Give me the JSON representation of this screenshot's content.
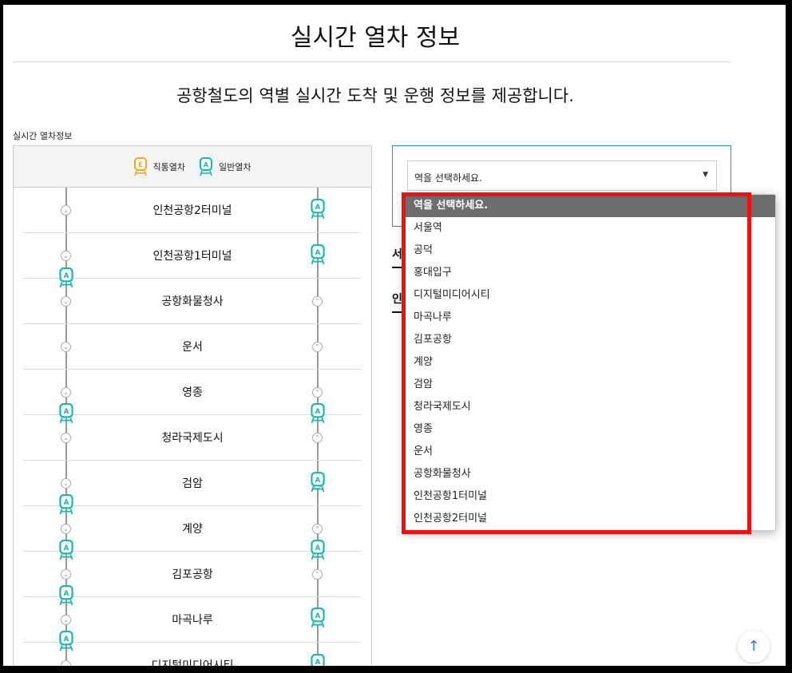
{
  "header": {
    "title": "실시간 열차 정보",
    "subtitle": "공항철도의 역별 실시간 도착 및 운행 정보를 제공합니다."
  },
  "section": {
    "label": "실시간 열차정보"
  },
  "legend": [
    {
      "icon": "express-train-icon",
      "badge": "E",
      "label": "직통열차",
      "color": "#f7a21b"
    },
    {
      "icon": "local-train-icon",
      "badge": "A",
      "label": "일반열차",
      "color": "#17b8b0"
    }
  ],
  "stations": [
    "인천공항2터미널",
    "인천공항1터미널",
    "공항화물청사",
    "운서",
    "영종",
    "청라국제도시",
    "검암",
    "계양",
    "김포공항",
    "마곡나루",
    "디지털미디어시티"
  ],
  "station_select": {
    "selected": "역을 선택하세요.",
    "options": [
      "역을 선택하세요.",
      "서울역",
      "공덕",
      "홍대입구",
      "디지털미디어시티",
      "마곡나루",
      "김포공항",
      "계양",
      "검암",
      "청라국제도시",
      "영종",
      "운서",
      "공항화물청사",
      "인천공항1터미널",
      "인천공항2터미널"
    ]
  },
  "partial_labels": [
    "서울",
    "인천"
  ],
  "top_button": {
    "icon": "arrow-up-icon",
    "glyph": "↑"
  },
  "colors": {
    "accent": "#2a95a8",
    "highlight": "#f01010",
    "selected_option": "#6d6d6d"
  }
}
